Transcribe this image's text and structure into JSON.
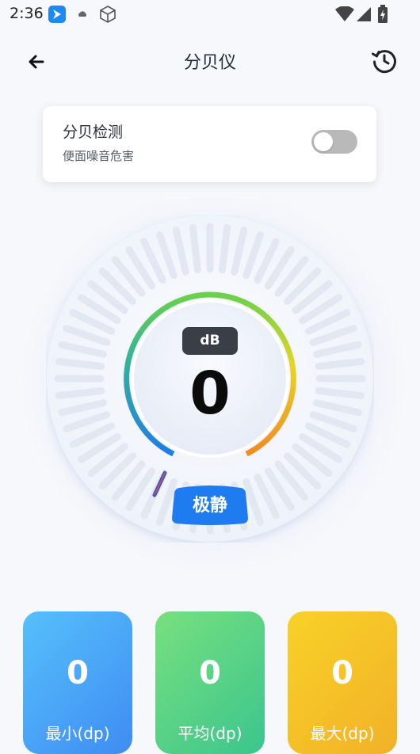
{
  "status_bar": {
    "time": "2:36",
    "notification_icons": [
      "app-notification-icon",
      "cloud-icon",
      "cube-icon"
    ],
    "system_icons": [
      "wifi-icon",
      "signal-icon",
      "battery-charging-icon"
    ]
  },
  "header": {
    "title": "分贝仪",
    "back_icon": "arrow-left-icon",
    "history_icon": "history-icon"
  },
  "detection_card": {
    "title": "分贝检测",
    "subtitle": "便面噪音危害",
    "toggle_on": false
  },
  "meter": {
    "unit": "dB",
    "reading": "0",
    "level_label": "极静",
    "colors": {
      "arc_start": "#1f7de6",
      "arc_mid": "#6ad14a",
      "arc_end": "#f08a23",
      "badge": "#1f7cf0"
    }
  },
  "stats": [
    {
      "value": "0",
      "label": "最小(dp)",
      "color": "#4aa8f7"
    },
    {
      "value": "0",
      "label": "平均(dp)",
      "color": "#5dd48a"
    },
    {
      "value": "0",
      "label": "最大(dp)",
      "color": "#f5c22a"
    }
  ]
}
